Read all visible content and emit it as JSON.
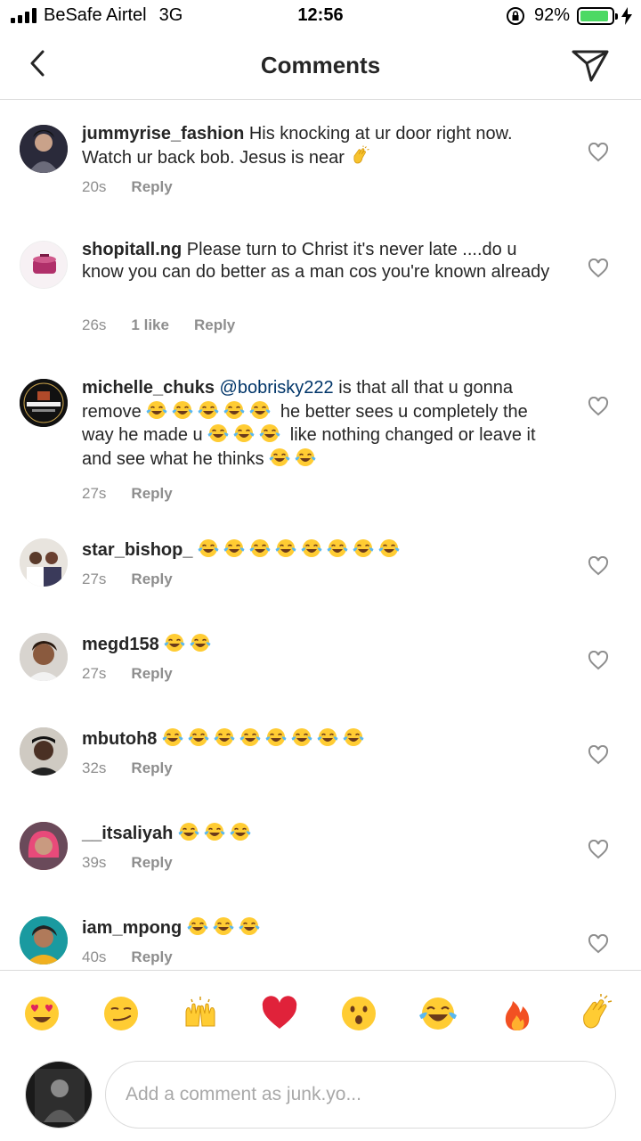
{
  "status_bar": {
    "carrier": "BeSafe Airtel",
    "network": "3G",
    "time": "12:56",
    "battery": "92%",
    "battery_level": 0.92,
    "battery_color": "#4cd964"
  },
  "header": {
    "title": "Comments",
    "back_icon": "chevron-left-icon",
    "send_icon": "paper-plane-icon"
  },
  "comments": [
    {
      "username": "jummyrise_fashion",
      "text": "His knocking at ur door right now. Watch ur back bob. Jesus is near",
      "emoji": [
        "clapping-hands"
      ],
      "time": "20s",
      "likes": "",
      "reply": "Reply"
    },
    {
      "username": "shopitall.ng",
      "text": "Please turn to Christ it's never late ....do u know you can do better as a man cos you're  known already",
      "emoji": [],
      "time": "26s",
      "likes": "1 like",
      "reply": "Reply"
    },
    {
      "username": "michelle_chuks",
      "mention": "@bobrisky222",
      "text_parts": [
        "is that all that u gonna remove",
        "he better sees u completely the way he made u",
        "like nothing changed or leave it and see what he thinks"
      ],
      "emoji_groups": [
        5,
        3,
        2
      ],
      "time": "27s",
      "likes": "",
      "reply": "Reply"
    },
    {
      "username": "star_bishop_",
      "text": "",
      "emoji_count": 8,
      "time": "27s",
      "likes": "",
      "reply": "Reply"
    },
    {
      "username": "megd158",
      "text": "",
      "emoji_count": 2,
      "time": "27s",
      "likes": "",
      "reply": "Reply"
    },
    {
      "username": "mbutoh8",
      "text": "",
      "emoji_count": 8,
      "time": "32s",
      "likes": "",
      "reply": "Reply"
    },
    {
      "username": "__itsaliyah",
      "text": "",
      "emoji_count": 3,
      "time": "39s",
      "likes": "",
      "reply": "Reply"
    },
    {
      "username": "iam_mpong",
      "text": "",
      "emoji_count": 3,
      "time": "40s",
      "likes": "",
      "reply": "Reply"
    }
  ],
  "emoji_bar": [
    "heart-eyes",
    "smirk",
    "raised-hands",
    "red-heart",
    "surprised",
    "tears-of-joy",
    "fire",
    "clapping-hands"
  ],
  "composer": {
    "placeholder": "Add a comment as junk.yo..."
  },
  "colors": {
    "mention": "#003569",
    "meta": "#8e8e8e",
    "divider": "#dbdbdb"
  }
}
